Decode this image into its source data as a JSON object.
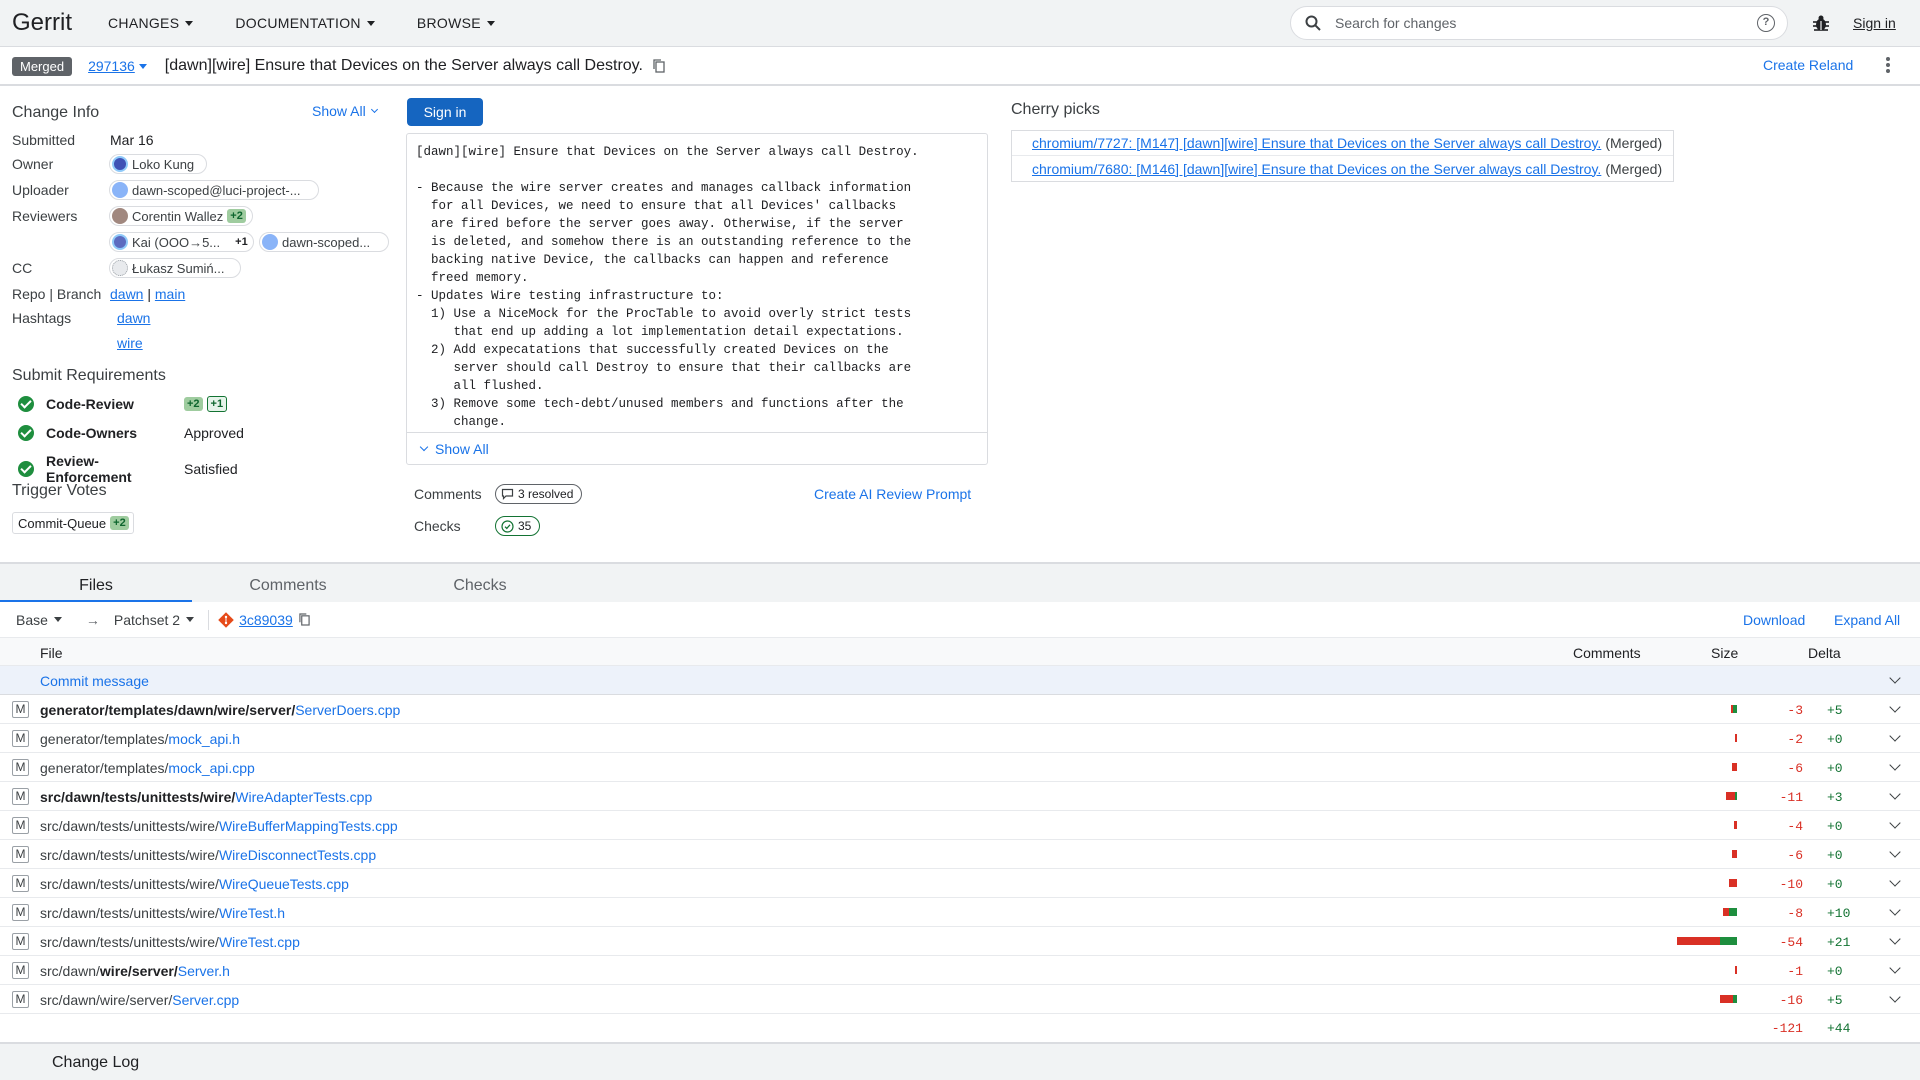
{
  "header": {
    "logo": "Gerrit",
    "menus": [
      "CHANGES",
      "DOCUMENTATION",
      "BROWSE"
    ],
    "search_placeholder": "Search for changes",
    "help": "?",
    "sign_in": "Sign in"
  },
  "titlebar": {
    "status": "Merged",
    "change_number": "297136",
    "subject": "[dawn][wire] Ensure that Devices on the Server always call Destroy.",
    "create_reland": "Create Reland"
  },
  "change_info": {
    "title": "Change Info",
    "show_all": "Show All",
    "submitted_label": "Submitted",
    "submitted": "Mar 16",
    "owner_label": "Owner",
    "owner": "Loko Kung",
    "uploader_label": "Uploader",
    "uploader": "dawn-scoped@luci-project-...",
    "reviewers_label": "Reviewers",
    "reviewers": [
      {
        "name": "Corentin Wallez",
        "vote": "+2"
      },
      {
        "name": "Kai (OOO→5...",
        "vote": "+1"
      },
      {
        "name": "dawn-scoped...",
        "vote": ""
      }
    ],
    "cc_label": "CC",
    "cc": "Łukasz Sumiń...",
    "repo_label": "Repo | Branch",
    "repo": "dawn",
    "branch": "main",
    "hashtags_label": "Hashtags",
    "hashtags": [
      "dawn",
      "wire"
    ]
  },
  "submit_requirements": {
    "title": "Submit Requirements",
    "items": [
      {
        "name": "Code-Review",
        "vote1": "+2",
        "vote2": "+1",
        "status": ""
      },
      {
        "name": "Code-Owners",
        "status": "Approved"
      },
      {
        "name": "Review-Enforcement",
        "status": "Satisfied"
      }
    ]
  },
  "trigger_votes": {
    "title": "Trigger Votes",
    "name": "Commit-Queue",
    "vote": "+2"
  },
  "commit": {
    "sign_in": "Sign in",
    "message": "[dawn][wire] Ensure that Devices on the Server always call Destroy.\n\n- Because the wire server creates and manages callback information\n  for all Devices, we need to ensure that all Devices' callbacks\n  are fired before the server goes away. Otherwise, if the server\n  is deleted, and somehow there is an outstanding reference to the\n  backing native Device, the callbacks can happen and reference\n  freed memory.\n- Updates Wire testing infrastructure to:\n  1) Use a NiceMock for the ProcTable to avoid overly strict tests\n     that end up adding a lot implementation detail expectations.\n  2) Add expecatations that successfully created Devices on the\n     server should call Destroy to ensure that their callbacks are\n     all flushed.\n  3) Remove some tech-debt/unused members and functions after the\n     change.",
    "show_all": "Show All",
    "comments_label": "Comments",
    "comments_value": "3 resolved",
    "checks_label": "Checks",
    "checks_value": "35",
    "ai_prompt": "Create AI Review Prompt"
  },
  "cherry_picks": {
    "title": "Cherry picks",
    "items": [
      {
        "link": "chromium/7727: [M147] [dawn][wire] Ensure that Devices on the Server always call Destroy.",
        "status": "(Merged)"
      },
      {
        "link": "chromium/7680: [M146] [dawn][wire] Ensure that Devices on the Server always call Destroy.",
        "status": "(Merged)"
      }
    ]
  },
  "tabs": [
    "Files",
    "Comments",
    "Checks"
  ],
  "files": {
    "base": "Base",
    "arrow": "→",
    "patchset": "Patchset 2",
    "commit_hash": "3c89039",
    "download": "Download",
    "expand_all": "Expand All",
    "col_file": "File",
    "col_comments": "Comments",
    "col_size": "Size",
    "col_delta": "Delta",
    "commit_message": "Commit message",
    "rows": [
      {
        "status": "M",
        "prefix": "",
        "bold": "generator/templates/dawn/wire/server/",
        "name": "ServerDoers.cpp",
        "del": "-3",
        "add": "+5"
      },
      {
        "status": "M",
        "prefix": "generator/templates/",
        "bold": "",
        "name": "mock_api.h",
        "del": "-2",
        "add": "+0"
      },
      {
        "status": "M",
        "prefix": "generator/templates/",
        "bold": "",
        "name": "mock_api.cpp",
        "del": "-6",
        "add": "+0"
      },
      {
        "status": "M",
        "prefix": "",
        "bold": "src/dawn/tests/unittests/wire/",
        "name": "WireAdapterTests.cpp",
        "del": "-11",
        "add": "+3"
      },
      {
        "status": "M",
        "prefix": "src/dawn/tests/unittests/wire/",
        "bold": "",
        "name": "WireBufferMappingTests.cpp",
        "del": "-4",
        "add": "+0"
      },
      {
        "status": "M",
        "prefix": "src/dawn/tests/unittests/wire/",
        "bold": "",
        "name": "WireDisconnectTests.cpp",
        "del": "-6",
        "add": "+0"
      },
      {
        "status": "M",
        "prefix": "src/dawn/tests/unittests/wire/",
        "bold": "",
        "name": "WireQueueTests.cpp",
        "del": "-10",
        "add": "+0"
      },
      {
        "status": "M",
        "prefix": "src/dawn/tests/unittests/wire/",
        "bold": "",
        "name": "WireTest.h",
        "del": "-8",
        "add": "+10"
      },
      {
        "status": "M",
        "prefix": "src/dawn/tests/unittests/wire/",
        "bold": "",
        "name": "WireTest.cpp",
        "del": "-54",
        "add": "+21"
      },
      {
        "status": "M",
        "prefix": "src/dawn/",
        "bold": "wire/server/",
        "name": "Server.h",
        "del": "-1",
        "add": "+0"
      },
      {
        "status": "M",
        "prefix": "src/dawn/wire/server/",
        "bold": "",
        "name": "Server.cpp",
        "del": "-16",
        "add": "+5"
      }
    ],
    "total_del": "-121",
    "total_add": "+44"
  },
  "change_log": "Change Log",
  "colors": {
    "accent": "#1a73e8",
    "merged": "#5f6368",
    "delete": "#d93025",
    "add": "#1e8e3e"
  }
}
